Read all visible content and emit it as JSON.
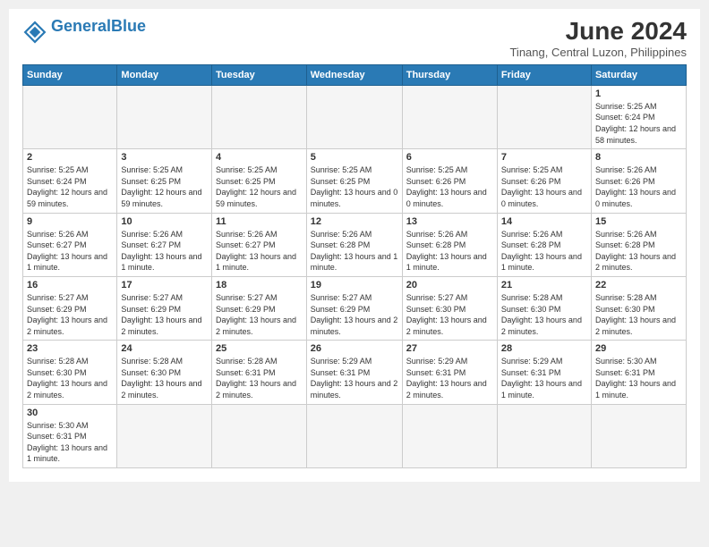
{
  "header": {
    "logo_general": "General",
    "logo_blue": "Blue",
    "month_year": "June 2024",
    "location": "Tinang, Central Luzon, Philippines"
  },
  "weekdays": [
    "Sunday",
    "Monday",
    "Tuesday",
    "Wednesday",
    "Thursday",
    "Friday",
    "Saturday"
  ],
  "weeks": [
    [
      null,
      null,
      null,
      null,
      null,
      null,
      {
        "day": "1",
        "sunrise": "5:25 AM",
        "sunset": "6:24 PM",
        "daylight": "12 hours and 58 minutes."
      }
    ],
    [
      {
        "day": "2",
        "sunrise": "5:25 AM",
        "sunset": "6:24 PM",
        "daylight": "12 hours and 59 minutes."
      },
      {
        "day": "3",
        "sunrise": "5:25 AM",
        "sunset": "6:25 PM",
        "daylight": "12 hours and 59 minutes."
      },
      {
        "day": "4",
        "sunrise": "5:25 AM",
        "sunset": "6:25 PM",
        "daylight": "12 hours and 59 minutes."
      },
      {
        "day": "5",
        "sunrise": "5:25 AM",
        "sunset": "6:25 PM",
        "daylight": "13 hours and 0 minutes."
      },
      {
        "day": "6",
        "sunrise": "5:25 AM",
        "sunset": "6:26 PM",
        "daylight": "13 hours and 0 minutes."
      },
      {
        "day": "7",
        "sunrise": "5:25 AM",
        "sunset": "6:26 PM",
        "daylight": "13 hours and 0 minutes."
      },
      {
        "day": "8",
        "sunrise": "5:26 AM",
        "sunset": "6:26 PM",
        "daylight": "13 hours and 0 minutes."
      }
    ],
    [
      {
        "day": "9",
        "sunrise": "5:26 AM",
        "sunset": "6:27 PM",
        "daylight": "13 hours and 1 minute."
      },
      {
        "day": "10",
        "sunrise": "5:26 AM",
        "sunset": "6:27 PM",
        "daylight": "13 hours and 1 minute."
      },
      {
        "day": "11",
        "sunrise": "5:26 AM",
        "sunset": "6:27 PM",
        "daylight": "13 hours and 1 minute."
      },
      {
        "day": "12",
        "sunrise": "5:26 AM",
        "sunset": "6:28 PM",
        "daylight": "13 hours and 1 minute."
      },
      {
        "day": "13",
        "sunrise": "5:26 AM",
        "sunset": "6:28 PM",
        "daylight": "13 hours and 1 minute."
      },
      {
        "day": "14",
        "sunrise": "5:26 AM",
        "sunset": "6:28 PM",
        "daylight": "13 hours and 1 minute."
      },
      {
        "day": "15",
        "sunrise": "5:26 AM",
        "sunset": "6:28 PM",
        "daylight": "13 hours and 2 minutes."
      }
    ],
    [
      {
        "day": "16",
        "sunrise": "5:27 AM",
        "sunset": "6:29 PM",
        "daylight": "13 hours and 2 minutes."
      },
      {
        "day": "17",
        "sunrise": "5:27 AM",
        "sunset": "6:29 PM",
        "daylight": "13 hours and 2 minutes."
      },
      {
        "day": "18",
        "sunrise": "5:27 AM",
        "sunset": "6:29 PM",
        "daylight": "13 hours and 2 minutes."
      },
      {
        "day": "19",
        "sunrise": "5:27 AM",
        "sunset": "6:29 PM",
        "daylight": "13 hours and 2 minutes."
      },
      {
        "day": "20",
        "sunrise": "5:27 AM",
        "sunset": "6:30 PM",
        "daylight": "13 hours and 2 minutes."
      },
      {
        "day": "21",
        "sunrise": "5:28 AM",
        "sunset": "6:30 PM",
        "daylight": "13 hours and 2 minutes."
      },
      {
        "day": "22",
        "sunrise": "5:28 AM",
        "sunset": "6:30 PM",
        "daylight": "13 hours and 2 minutes."
      }
    ],
    [
      {
        "day": "23",
        "sunrise": "5:28 AM",
        "sunset": "6:30 PM",
        "daylight": "13 hours and 2 minutes."
      },
      {
        "day": "24",
        "sunrise": "5:28 AM",
        "sunset": "6:30 PM",
        "daylight": "13 hours and 2 minutes."
      },
      {
        "day": "25",
        "sunrise": "5:28 AM",
        "sunset": "6:31 PM",
        "daylight": "13 hours and 2 minutes."
      },
      {
        "day": "26",
        "sunrise": "5:29 AM",
        "sunset": "6:31 PM",
        "daylight": "13 hours and 2 minutes."
      },
      {
        "day": "27",
        "sunrise": "5:29 AM",
        "sunset": "6:31 PM",
        "daylight": "13 hours and 2 minutes."
      },
      {
        "day": "28",
        "sunrise": "5:29 AM",
        "sunset": "6:31 PM",
        "daylight": "13 hours and 1 minute."
      },
      {
        "day": "29",
        "sunrise": "5:30 AM",
        "sunset": "6:31 PM",
        "daylight": "13 hours and 1 minute."
      }
    ],
    [
      {
        "day": "30",
        "sunrise": "5:30 AM",
        "sunset": "6:31 PM",
        "daylight": "13 hours and 1 minute."
      },
      null,
      null,
      null,
      null,
      null,
      null
    ]
  ],
  "labels": {
    "sunrise": "Sunrise:",
    "sunset": "Sunset:",
    "daylight": "Daylight:"
  }
}
